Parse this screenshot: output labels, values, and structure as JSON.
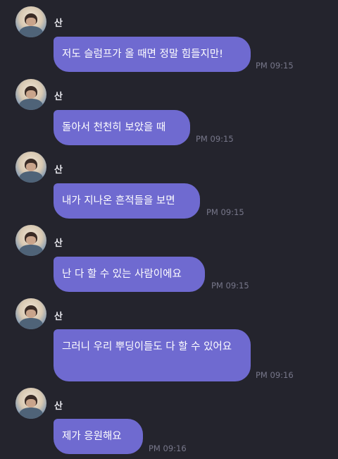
{
  "chat": {
    "messages": [
      {
        "sender": "산",
        "text": "저도 슬럼프가 올 때면 정말 힘들지만!",
        "time": "PM 09:15"
      },
      {
        "sender": "산",
        "text": "돌아서 천천히 보았을 때",
        "time": "PM 09:15"
      },
      {
        "sender": "산",
        "text": "내가 지나온 흔적들을 보면",
        "time": "PM 09:15"
      },
      {
        "sender": "산",
        "text": "난 다 할 수 있는 사람이에요",
        "time": "PM 09:15"
      },
      {
        "sender": "산",
        "text": "그러니 우리 뿌딩이들도 다 할 수 있어요",
        "time": "PM 09:16"
      },
      {
        "sender": "산",
        "text": "제가 응원해요",
        "time": "PM 09:16"
      }
    ]
  },
  "colors": {
    "background": "#24242d",
    "bubble": "#6f6ad0",
    "timestamp": "#77778a",
    "sender": "#e8e8ee"
  }
}
